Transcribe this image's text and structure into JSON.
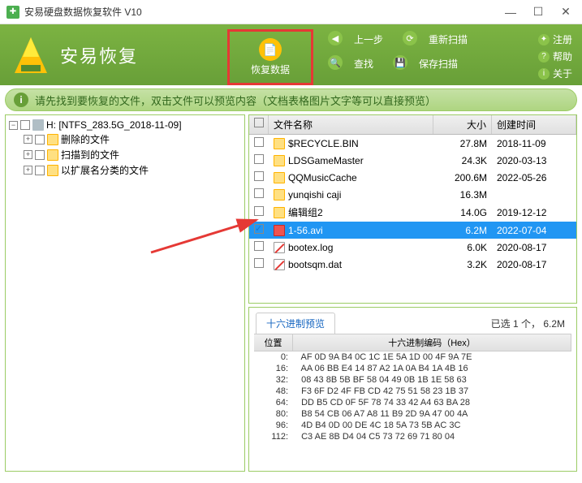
{
  "window": {
    "title": "安易硬盘数据恢复软件 V10"
  },
  "logo": {
    "text": "安易恢复"
  },
  "toolbar": {
    "recover": "恢复数据",
    "back": "上一步",
    "rescan": "重新扫描",
    "search": "查找",
    "save_scan": "保存扫描"
  },
  "rightbar": {
    "register": "注册",
    "help": "帮助",
    "about": "关于"
  },
  "info": "请先找到要恢复的文件，双击文件可以预览内容（文档表格图片文字等可以直接预览）",
  "tree": {
    "root": "H: [NTFS_283.5G_2018-11-09]",
    "children": [
      "删除的文件",
      "扫描到的文件",
      "以扩展名分类的文件"
    ]
  },
  "cols": {
    "name": "文件名称",
    "size": "大小",
    "date": "创建时间"
  },
  "files": [
    {
      "name": "$RECYCLE.BIN",
      "size": "27.8M",
      "date": "2018-11-09",
      "type": "folder",
      "checked": false
    },
    {
      "name": "LDSGameMaster",
      "size": "24.3K",
      "date": "2020-03-13",
      "type": "folder",
      "checked": false
    },
    {
      "name": "QQMusicCache",
      "size": "200.6M",
      "date": "2022-05-26",
      "type": "folder",
      "checked": false
    },
    {
      "name": "yunqishi caji",
      "size": "16.3M",
      "date": "",
      "type": "folder",
      "checked": false
    },
    {
      "name": "编辑组2",
      "size": "14.0G",
      "date": "2019-12-12",
      "type": "folder",
      "checked": false
    },
    {
      "name": "1-56.avi",
      "size": "6.2M",
      "date": "2022-07-04",
      "type": "file",
      "checked": true,
      "selected": true
    },
    {
      "name": "bootex.log",
      "size": "6.0K",
      "date": "2020-08-17",
      "type": "bad",
      "checked": false
    },
    {
      "name": "bootsqm.dat",
      "size": "3.2K",
      "date": "2020-08-17",
      "type": "bad",
      "checked": false
    }
  ],
  "status": "已选 1 个，  6.2M",
  "hex": {
    "tab": "十六进制预览",
    "col_offset": "位置",
    "col_bytes": "十六进制编码（Hex）",
    "rows": [
      {
        "off": "0:",
        "b": "AF 0D 9A B4 0C 1C 1E 5A 1D 00 4F 9A 7E"
      },
      {
        "off": "16:",
        "b": "AA 06 BB E4 14 87 A2 1A 0A B4 1A 4B 16"
      },
      {
        "off": "32:",
        "b": "08 43 8B 5B BF 58 04 49 0B 1B 1E 58 63"
      },
      {
        "off": "48:",
        "b": "F3 6F D2 4F FB CD 42 75 51 58 23 1B 37"
      },
      {
        "off": "64:",
        "b": "DD B5 CD 0F 5F 78 74 33 42 A4 63 BA 28"
      },
      {
        "off": "80:",
        "b": "B8 54 CB 06 A7 A8 11 B9 2D 9A 47 00 4A"
      },
      {
        "off": "96:",
        "b": "4D B4 0D 00 DE 4C 18 5A 73 5B AC 3C"
      },
      {
        "off": "112:",
        "b": "C3 AE 8B D4 04 C5 73 72 69 71 80 04"
      }
    ]
  }
}
